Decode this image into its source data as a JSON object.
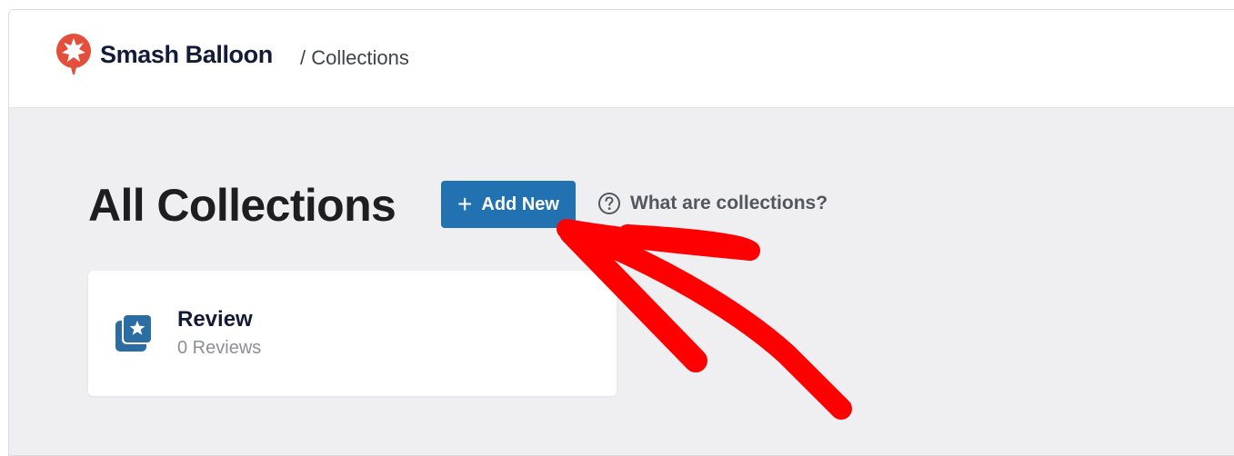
{
  "header": {
    "brand": "Smash Balloon",
    "breadcrumb": "/ Collections",
    "logo_icon": "smash-balloon-logo-icon"
  },
  "main": {
    "title": "All Collections",
    "add_button_label": "Add New",
    "add_button_icon": "plus-icon",
    "help_link": "What are collections?",
    "help_icon": "question-circle-icon"
  },
  "collections": [
    {
      "name": "Review",
      "count_text": "0 Reviews",
      "icon": "collection-star-icon"
    }
  ],
  "colors": {
    "brand_red": "#e34f3b",
    "button_blue": "#2271b1",
    "annotation_red": "#ff0000",
    "background": "#efeff2"
  }
}
